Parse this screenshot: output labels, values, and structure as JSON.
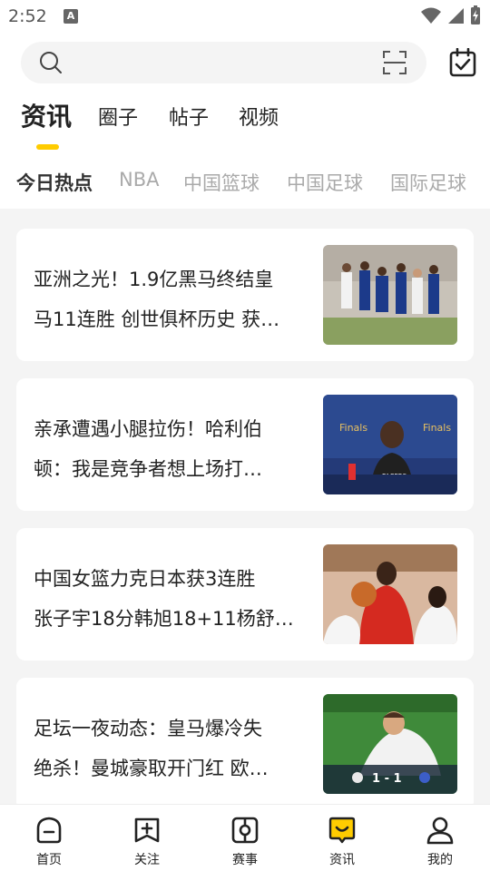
{
  "status_bar": {
    "time": "2:52",
    "notification_letter": "A"
  },
  "search": {
    "placeholder": ""
  },
  "main_tabs": [
    {
      "label": "资讯",
      "active": true
    },
    {
      "label": "圈子",
      "active": false
    },
    {
      "label": "帖子",
      "active": false
    },
    {
      "label": "视频",
      "active": false
    }
  ],
  "sub_tabs": [
    {
      "label": "今日热点",
      "active": true
    },
    {
      "label": "NBA",
      "active": false
    },
    {
      "label": "中国篮球",
      "active": false
    },
    {
      "label": "中国足球",
      "active": false
    },
    {
      "label": "国际足球",
      "active": false
    }
  ],
  "articles": [
    {
      "line1": "亚洲之光！1.9亿黑马终结皇",
      "line2": "马11连胜 创世俱杯历史 获…"
    },
    {
      "line1": "亲承遭遇小腿拉伤！哈利伯",
      "line2": "顿：我是竞争者想上场打…"
    },
    {
      "line1": "中国女篮力克日本获3连胜",
      "line2": "张子宇18分韩旭18+11杨舒…"
    },
    {
      "line1": "足坛一夜动态：皇马爆冷失",
      "line2": "绝杀！曼城豪取开门红 欧…"
    }
  ],
  "thumb_text": {
    "finals": "Finals",
    "jersey": "PACERS",
    "score": "1 - 1"
  },
  "bottom_nav": [
    {
      "label": "首页",
      "icon": "home-icon"
    },
    {
      "label": "关注",
      "icon": "follow-icon"
    },
    {
      "label": "赛事",
      "icon": "match-icon"
    },
    {
      "label": "资讯",
      "icon": "news-icon"
    },
    {
      "label": "我的",
      "icon": "profile-icon"
    }
  ],
  "colors": {
    "accent": "#ffcc00",
    "background": "#f4f4f4",
    "card": "#ffffff"
  }
}
